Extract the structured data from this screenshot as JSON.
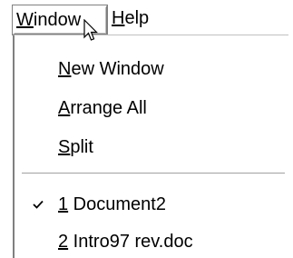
{
  "menubar": {
    "window": {
      "prefix": "",
      "accel": "W",
      "rest": "indow"
    },
    "help": {
      "prefix": "",
      "accel": "H",
      "rest": "elp"
    }
  },
  "menu": {
    "new_window": {
      "accel": "N",
      "rest": "ew Window"
    },
    "arrange_all": {
      "accel": "A",
      "rest": "rrange All"
    },
    "split": {
      "accel": "S",
      "rest": "plit"
    },
    "windows": [
      {
        "accel": "1",
        "rest": " Document2",
        "checked": true
      },
      {
        "accel": "2",
        "rest": " Intro97 rev.doc",
        "checked": false
      }
    ]
  },
  "icons": {
    "cursor": "arrow-cursor-icon",
    "check": "checkmark-icon"
  }
}
